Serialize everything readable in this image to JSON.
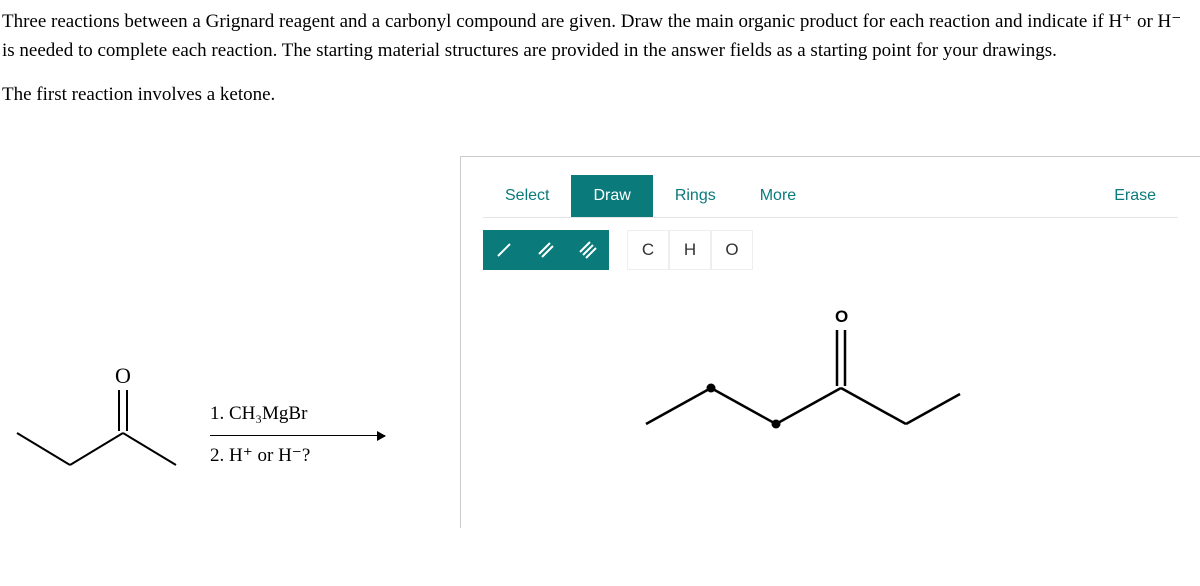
{
  "question": {
    "para1": "Three reactions between a Grignard reagent and a carbonyl compound are given. Draw the main organic product for each reaction and indicate if H⁺ or H⁻ is needed to complete each reaction. The starting material structures are provided in the answer fields as a starting point for your drawings.",
    "para2": "The first reaction involves a ketone."
  },
  "reaction": {
    "step1": "1. CH₃MgBr",
    "step2": "2. H⁺ or H⁻?"
  },
  "toolbar": {
    "select": "Select",
    "draw": "Draw",
    "rings": "Rings",
    "more": "More",
    "erase": "Erase"
  },
  "tools": {
    "single": "/",
    "double": "//",
    "triple": "///",
    "C": "C",
    "H": "H",
    "O": "O"
  },
  "canvas_label": "O"
}
